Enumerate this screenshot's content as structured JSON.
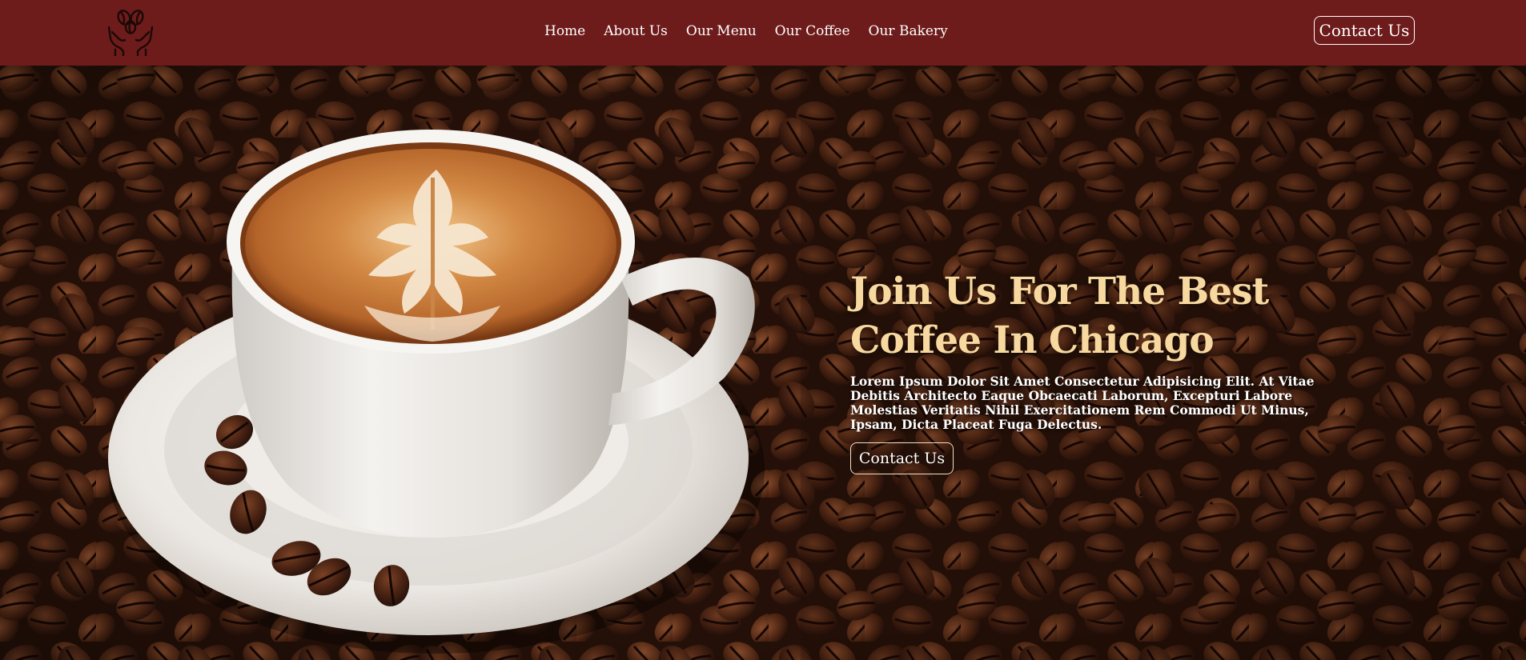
{
  "header": {
    "logo_icon": "coffee-beans-hands-icon",
    "nav": [
      {
        "label": "Home"
      },
      {
        "label": "About Us"
      },
      {
        "label": "Our Menu"
      },
      {
        "label": "Our Coffee"
      },
      {
        "label": "Our Bakery"
      }
    ],
    "contact_label": "Contact Us"
  },
  "hero": {
    "title": "Join Us For The Best Coffee In Chicago",
    "description": "Lorem Ipsum Dolor Sit Amet Consectetur Adipisicing Elit. At Vitae Debitis Architecto Eaque Obcaecati Laborum, Excepturi Labore Molestias Veritatis Nihil Exercitationem Rem Commodi Ut Minus, Ipsam, Dicta Placeat Fuga Delectus.",
    "cta_label": "Contact Us",
    "image": "coffee-cup-on-beans-image"
  },
  "colors": {
    "navbar": "#6e1b1b",
    "title": "#f7d9a0",
    "text": "#ffffff",
    "beans_dark": "#2e160c",
    "beans_mid": "#5a2e18"
  }
}
